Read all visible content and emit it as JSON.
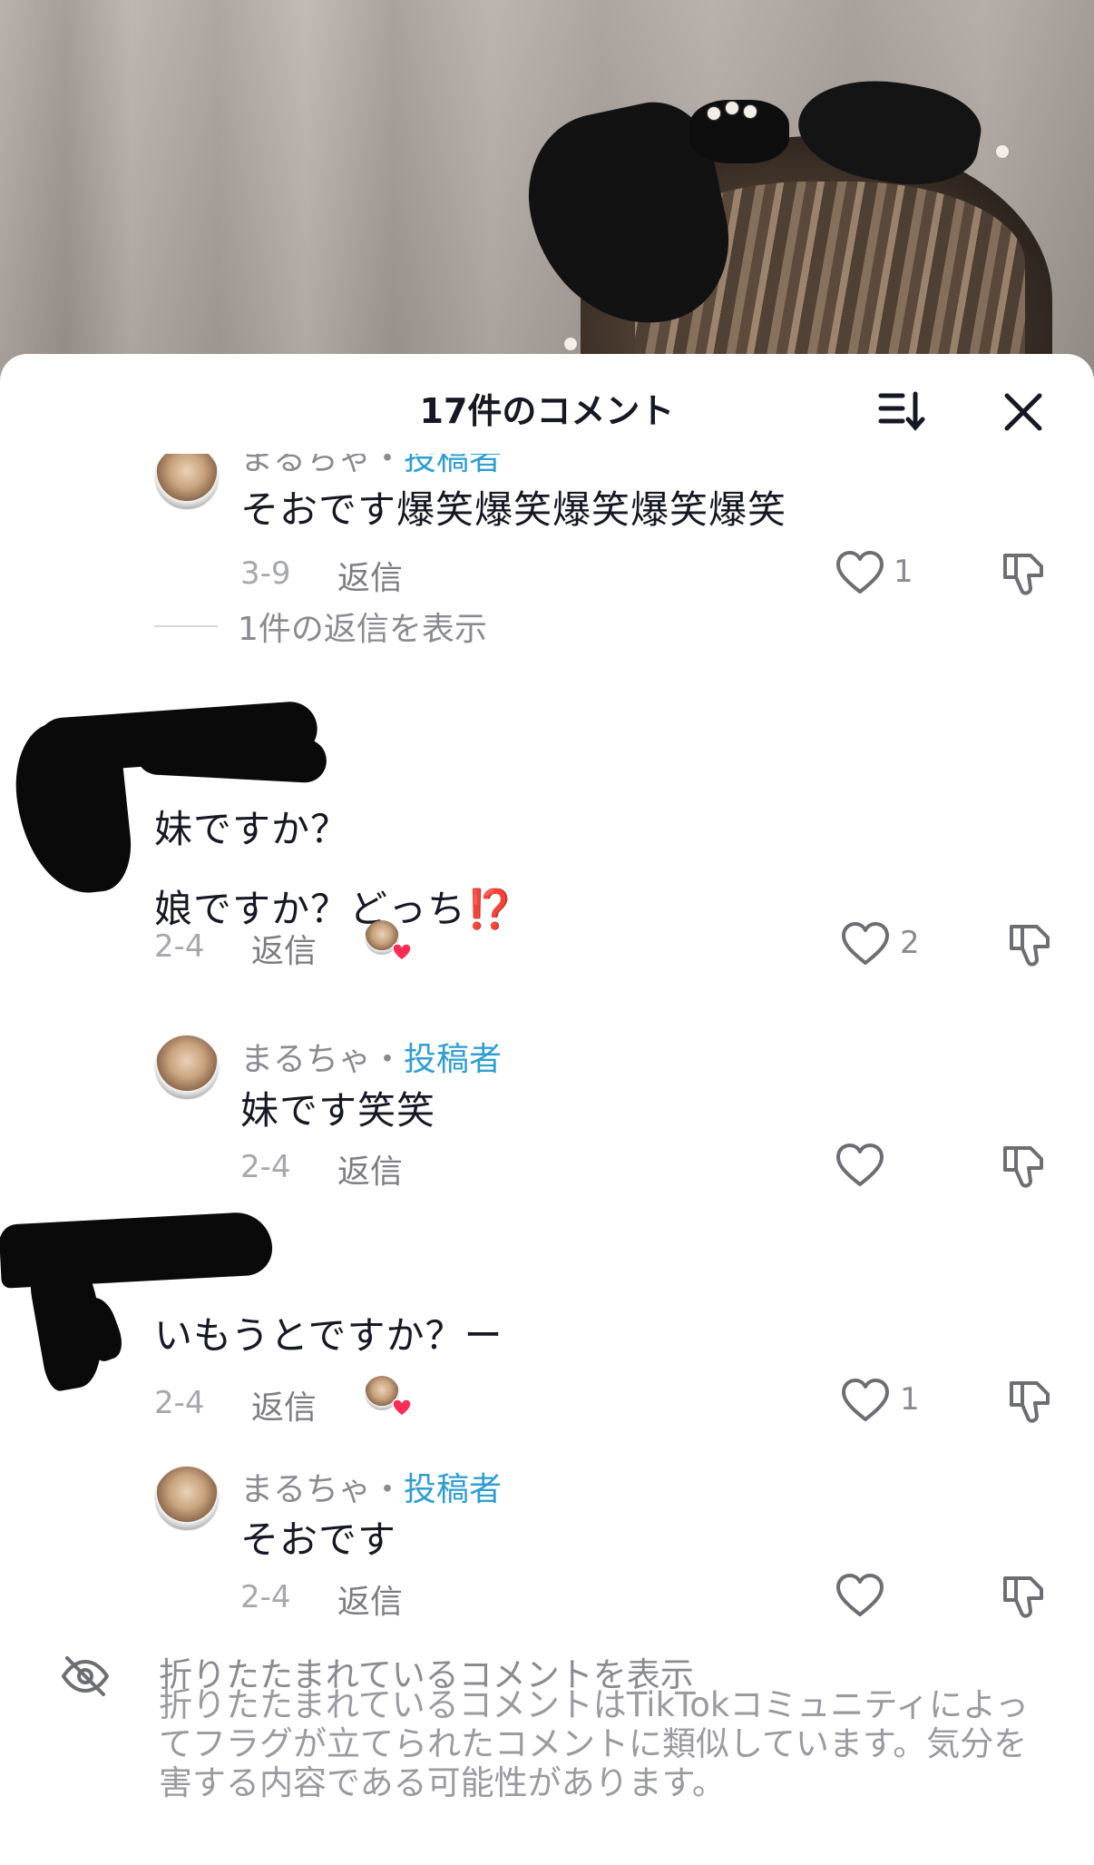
{
  "sheet": {
    "title": "17件のコメント"
  },
  "comments": [
    {
      "author": "まるちゃ",
      "separator": "・",
      "author_tag": "投稿者",
      "text": "そおです爆笑爆笑爆笑爆笑爆笑",
      "date": "3-9",
      "reply_label": "返信",
      "likes": "1",
      "view_replies": "1件の返信を表示"
    },
    {
      "text_line1": "妹ですか？",
      "text_line2": "娘ですか？どっち⁉️",
      "date": "2-4",
      "reply_label": "返信",
      "likes": "2"
    },
    {
      "author": "まるちゃ",
      "separator": "・",
      "author_tag": "投稿者",
      "text": "妹です笑笑",
      "date": "2-4",
      "reply_label": "返信",
      "likes": ""
    },
    {
      "text": "いもうとですか？ー",
      "date": "2-4",
      "reply_label": "返信",
      "likes": "1"
    },
    {
      "author": "まるちゃ",
      "separator": "・",
      "author_tag": "投稿者",
      "text": "そおです",
      "date": "2-4",
      "reply_label": "返信",
      "likes": ""
    }
  ],
  "folded": {
    "title": "折りたたまれているコメントを表示",
    "description": "折りたたまれているコメントはTikTokコミュニティによってフラグが立てられたコメントに類似しています。気分を害する内容である可能性があります。"
  },
  "icons": {
    "sort": "sort-icon",
    "close": "close-icon",
    "like": "heart-icon",
    "dislike": "thumbs-down-icon",
    "hidden": "eye-slash-icon",
    "creator_liked": "heart-badge-icon"
  },
  "colors": {
    "creator_tag": "#2f9fd0",
    "text": "#161823",
    "muted": "#8a8b91",
    "heart_badge": "#fe2c55",
    "emoji_red": "#e0302a"
  }
}
